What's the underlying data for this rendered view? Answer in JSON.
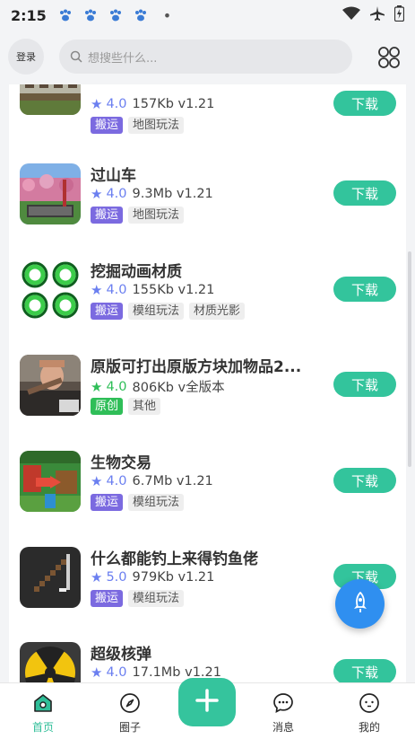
{
  "status_bar": {
    "time": "2:15"
  },
  "topbar": {
    "login_label": "登录",
    "search_placeholder": "想搜些什么..."
  },
  "colors": {
    "accent": "#33c49c",
    "primary_tag": "#7b6ae0",
    "original_tag": "#2fbe58",
    "star_blue": "#6b7ff0",
    "star_green": "#2fbe58",
    "fab": "#2f8ff0"
  },
  "list": {
    "download_label": "下载",
    "items": [
      {
        "title": "",
        "rating": "4.0",
        "size_version": "157Kb v1.21",
        "tags": [
          "搬运",
          "地图玩法"
        ],
        "thumb": "house-building"
      },
      {
        "title": "过山车",
        "rating": "4.0",
        "size_version": "9.3Mb v1.21",
        "tags": [
          "搬运",
          "地图玩法"
        ],
        "thumb": "roller-coaster"
      },
      {
        "title": "挖掘动画材质",
        "rating": "4.0",
        "size_version": "155Kb v1.21",
        "tags": [
          "搬运",
          "模组玩法",
          "材质光影"
        ],
        "thumb": "green-rings"
      },
      {
        "title": "原版可打出原版方块加物品2...",
        "rating": "4.0",
        "size_version": "806Kb v全版本",
        "tags": [
          "原创",
          "其他"
        ],
        "thumb": "person-photo"
      },
      {
        "title": "生物交易",
        "rating": "4.0",
        "size_version": "6.7Mb v1.21",
        "tags": [
          "搬运",
          "模组玩法"
        ],
        "thumb": "trading-all-mobs"
      },
      {
        "title": "什么都能钓上来得钓鱼佬",
        "rating": "5.0",
        "size_version": "979Kb v1.21",
        "tags": [
          "搬运",
          "模组玩法"
        ],
        "thumb": "fishing-rod"
      },
      {
        "title": "超级核弹",
        "rating": "4.0",
        "size_version": "17.1Mb v1.21",
        "tags": [],
        "thumb": "nuclear-sign"
      }
    ]
  },
  "bottom_nav": {
    "home": "首页",
    "circle": "圈子",
    "messages": "消息",
    "mine": "我的"
  }
}
